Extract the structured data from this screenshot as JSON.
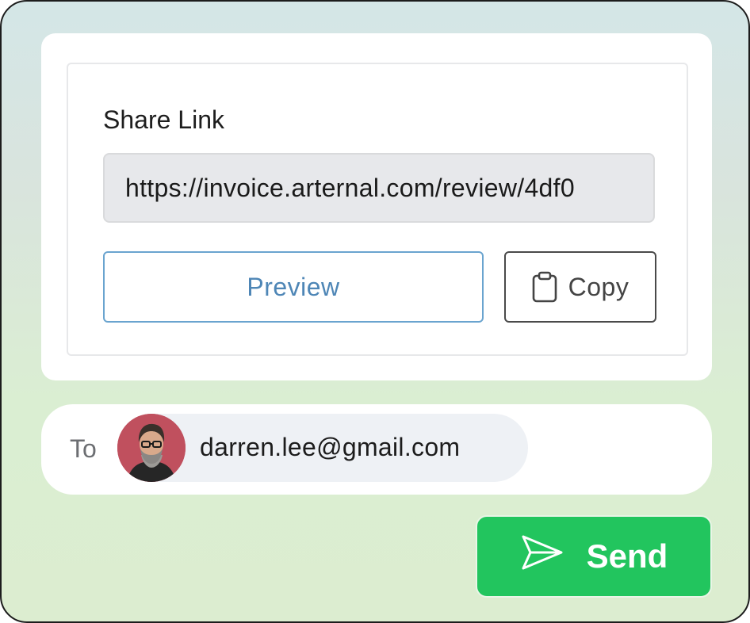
{
  "share": {
    "label": "Share Link",
    "link_value": "https://invoice.arternal.com/review/4df0",
    "preview_label": "Preview",
    "copy_label": "Copy",
    "copy_icon": "clipboard-icon"
  },
  "recipient": {
    "to_label": "To",
    "email": "darren.lee@gmail.com",
    "avatar": "user-avatar"
  },
  "send": {
    "label": "Send",
    "icon": "paper-plane-icon"
  },
  "colors": {
    "accent_green": "#22c55e",
    "preview_blue": "#4e86b6",
    "avatar_bg": "#c0505e"
  }
}
